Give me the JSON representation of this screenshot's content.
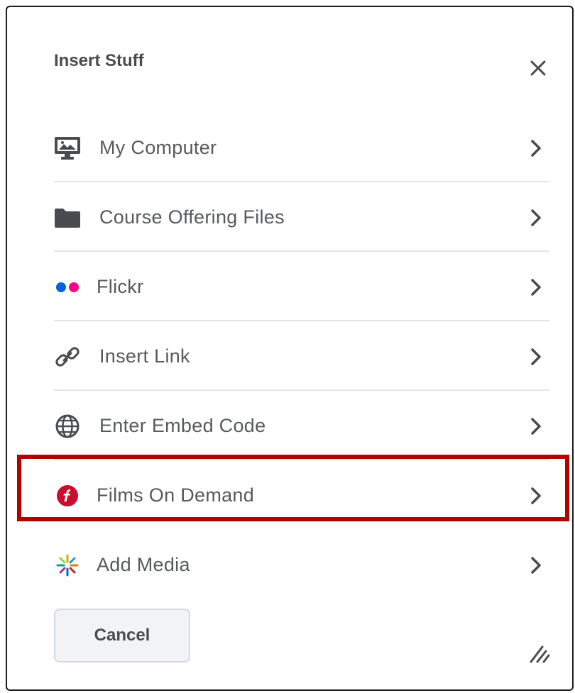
{
  "dialog": {
    "title": "Insert Stuff",
    "close_icon": "close-icon"
  },
  "items": [
    {
      "label": "My Computer",
      "icon": "computer-monitor-icon"
    },
    {
      "label": "Course Offering Files",
      "icon": "folder-icon"
    },
    {
      "label": "Flickr",
      "icon": "flickr-icon"
    },
    {
      "label": "Insert Link",
      "icon": "link-icon"
    },
    {
      "label": "Enter Embed Code",
      "icon": "globe-icon"
    },
    {
      "label": "Films On Demand",
      "icon": "films-on-demand-icon"
    },
    {
      "label": "Add Media",
      "icon": "add-media-icon"
    }
  ],
  "highlighted_item": "Films On Demand",
  "footer": {
    "cancel_label": "Cancel",
    "resize_icon": "resize-handle-icon"
  },
  "colors": {
    "highlight_border": "#b30000",
    "text": "#565a5c",
    "title": "#494c4e",
    "divider": "#e3e6e9",
    "flickr_blue": "#0063dc",
    "flickr_pink": "#ff0084",
    "films_red": "#c8102e"
  }
}
